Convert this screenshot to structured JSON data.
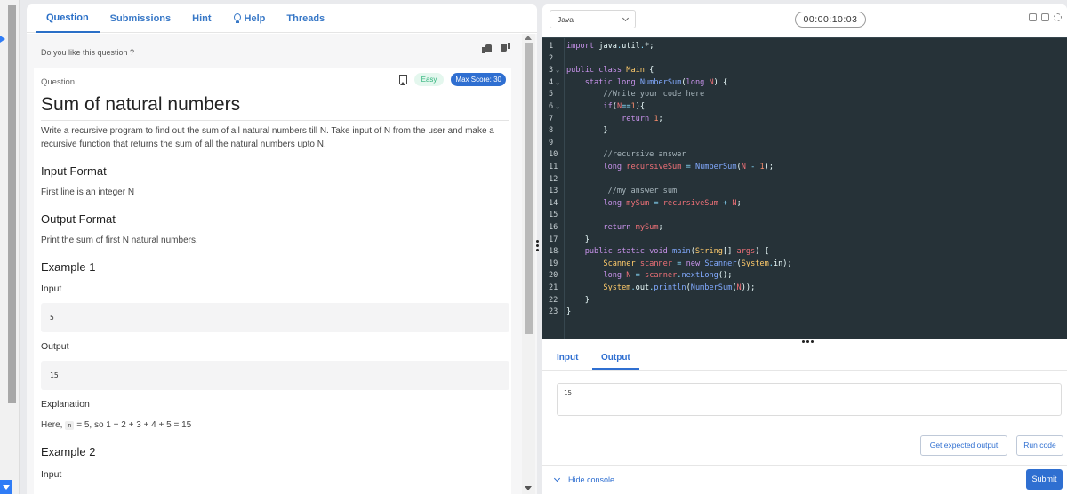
{
  "tabs": [
    {
      "label": "Question",
      "active": true
    },
    {
      "label": "Submissions"
    },
    {
      "label": "Hint"
    },
    {
      "label": "Help",
      "icon": "bulb-icon"
    },
    {
      "label": "Threads"
    }
  ],
  "feedback": {
    "prompt": "Do you like this question ?"
  },
  "question": {
    "label": "Question",
    "difficulty": "Easy",
    "max_score": "Max Score: 30",
    "title": "Sum of natural numbers",
    "description": "Write a recursive program to find out the sum of all natural numbers till N. Take input of N from the user and make a recursive function that returns the sum of all the natural numbers upto N.",
    "input_format_heading": "Input Format",
    "input_format": "First line is an integer N",
    "output_format_heading": "Output Format",
    "output_format": "Print the sum of first N natural numbers.",
    "example1_heading": "Example 1",
    "example1_input_label": "Input",
    "example1_input": "5",
    "example1_output_label": "Output",
    "example1_output": "15",
    "explanation_label": "Explanation",
    "explanation_prefix": "Here,",
    "explanation_code": "n",
    "explanation_rest": "= 5, so 1 + 2 + 3 + 4 + 5 = 15",
    "example2_heading": "Example 2",
    "example2_input_label": "Input"
  },
  "editor": {
    "language": "Java",
    "timer": "00:00:10:03",
    "line_numbers": [
      "1",
      "2",
      "3",
      "4",
      "5",
      "6",
      "7",
      "8",
      "9",
      "10",
      "11",
      "12",
      "13",
      "14",
      "15",
      "16",
      "17",
      "18",
      "19",
      "20",
      "21",
      "22",
      "23"
    ]
  },
  "console": {
    "tabs": [
      "Input",
      "Output"
    ],
    "active_tab": "Output",
    "output": "15",
    "get_expected_output": "Get expected output",
    "run_code": "Run code",
    "hide_console": "Hide console",
    "submit": "Submit"
  },
  "colors": {
    "accent": "#2f6fd1",
    "editor_bg": "#263238",
    "easy_green": "#2fb37b"
  }
}
